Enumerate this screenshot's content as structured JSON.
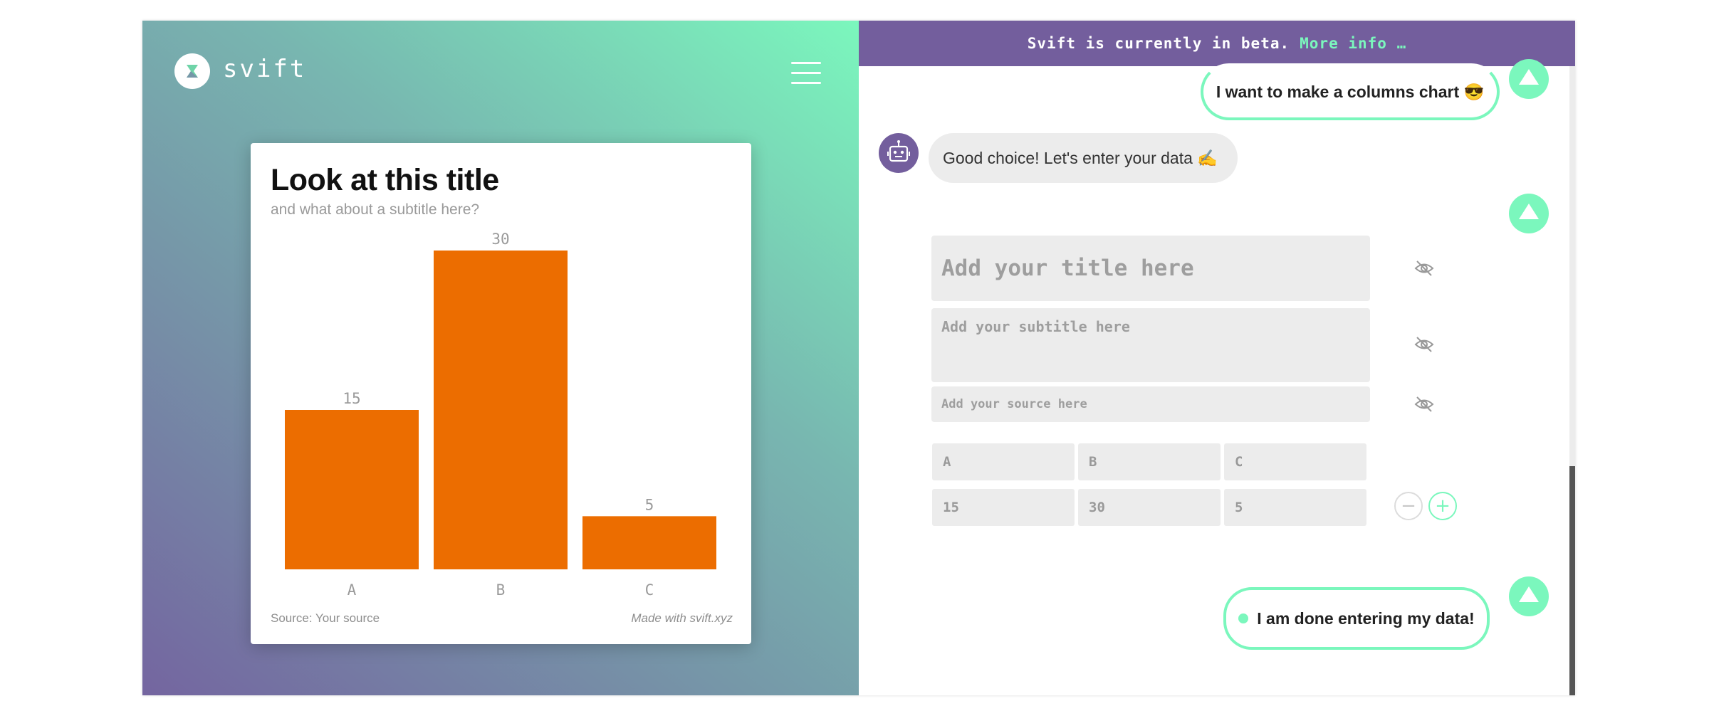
{
  "brand": {
    "name": "svift"
  },
  "banner": {
    "text": "Svift is currently in beta.",
    "link": "More info …"
  },
  "chat": {
    "user_message": "I want to make a columns chart 😎",
    "bot_message": "Good choice! Let's enter your data ✍️",
    "done_button": "I am done entering my data!"
  },
  "form": {
    "title_placeholder": "Add your title here",
    "subtitle_placeholder": "Add your subtitle here",
    "source_placeholder": "Add your source here",
    "table": {
      "headers": [
        "A",
        "B",
        "C"
      ],
      "values": [
        "15",
        "30",
        "5"
      ]
    },
    "minus_label": "−",
    "plus_label": "+"
  },
  "chart": {
    "title": "Look at this title",
    "subtitle": "and what about a subtitle here?",
    "source": "Source: Your source",
    "made_with": "Made with svift.xyz"
  },
  "chart_data": {
    "type": "bar",
    "categories": [
      "A",
      "B",
      "C"
    ],
    "values": [
      15,
      30,
      5
    ],
    "title": "Look at this title",
    "subtitle": "and what about a subtitle here?",
    "ylim": [
      0,
      30
    ],
    "grid": false,
    "color": "#ec6d00"
  },
  "colors": {
    "accent": "#7bf7bd",
    "purple": "#735e9d",
    "bar": "#ec6d00"
  },
  "icons": {
    "menu": "hamburger-icon",
    "visibility": "eye-slash-icon",
    "collapse": "chevron-up-icon",
    "bot": "robot-icon"
  }
}
